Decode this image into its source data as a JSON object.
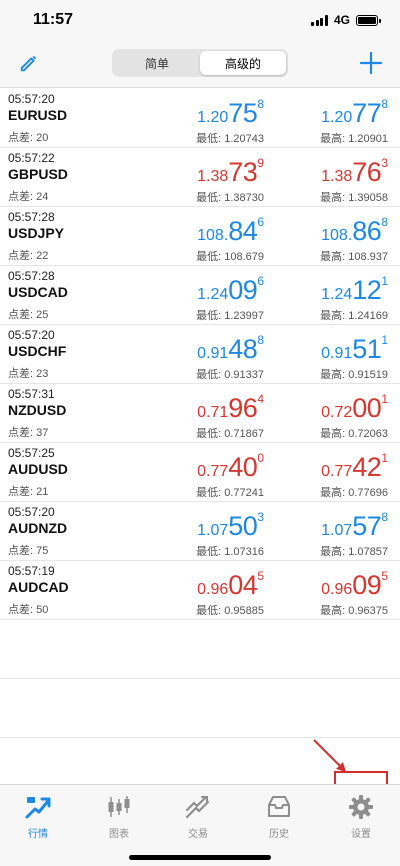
{
  "status": {
    "time": "11:57",
    "network": "4G"
  },
  "toolbar": {
    "segments": [
      {
        "label": "简单"
      },
      {
        "label": "高级的"
      }
    ]
  },
  "quotes": [
    {
      "time": "05:57:20",
      "symbol": "EURUSD",
      "spread": "点差: 20",
      "bid": {
        "small": "1.20",
        "big": "75",
        "sup": "8"
      },
      "ask": {
        "small": "1.20",
        "big": "77",
        "sup": "8"
      },
      "low": "最低: 1.20743",
      "high": "最高: 1.20901"
    },
    {
      "time": "05:57:22",
      "symbol": "GBPUSD",
      "spread": "点差: 24",
      "bid": {
        "small": "1.38",
        "big": "73",
        "sup": "9"
      },
      "ask": {
        "small": "1.38",
        "big": "76",
        "sup": "3"
      },
      "low": "最低: 1.38730",
      "high": "最高: 1.39058"
    },
    {
      "time": "05:57:28",
      "symbol": "USDJPY",
      "spread": "点差: 22",
      "bid": {
        "small": "108.",
        "big": "84",
        "sup": "6"
      },
      "ask": {
        "small": "108.",
        "big": "86",
        "sup": "8"
      },
      "low": "最低: 108.679",
      "high": "最高: 108.937"
    },
    {
      "time": "05:57:28",
      "symbol": "USDCAD",
      "spread": "点差: 25",
      "bid": {
        "small": "1.24",
        "big": "09",
        "sup": "6"
      },
      "ask": {
        "small": "1.24",
        "big": "12",
        "sup": "1"
      },
      "low": "最低: 1.23997",
      "high": "最高: 1.24169"
    },
    {
      "time": "05:57:20",
      "symbol": "USDCHF",
      "spread": "点差: 23",
      "bid": {
        "small": "0.91",
        "big": "48",
        "sup": "8"
      },
      "ask": {
        "small": "0.91",
        "big": "51",
        "sup": "1"
      },
      "low": "最低: 0.91337",
      "high": "最高: 0.91519"
    },
    {
      "time": "05:57:31",
      "symbol": "NZDUSD",
      "spread": "点差: 37",
      "bid": {
        "small": "0.71",
        "big": "96",
        "sup": "4"
      },
      "ask": {
        "small": "0.72",
        "big": "00",
        "sup": "1"
      },
      "low": "最低: 0.71867",
      "high": "最高: 0.72063"
    },
    {
      "time": "05:57:25",
      "symbol": "AUDUSD",
      "spread": "点差: 21",
      "bid": {
        "small": "0.77",
        "big": "40",
        "sup": "0"
      },
      "ask": {
        "small": "0.77",
        "big": "42",
        "sup": "1"
      },
      "low": "最低: 0.77241",
      "high": "最高: 0.77696"
    },
    {
      "time": "05:57:20",
      "symbol": "AUDNZD",
      "spread": "点差: 75",
      "bid": {
        "small": "1.07",
        "big": "50",
        "sup": "3"
      },
      "ask": {
        "small": "1.07",
        "big": "57",
        "sup": "8"
      },
      "low": "最低: 1.07316",
      "high": "最高: 1.07857"
    },
    {
      "time": "05:57:19",
      "symbol": "AUDCAD",
      "spread": "点差: 50",
      "bid": {
        "small": "0.96",
        "big": "04",
        "sup": "5"
      },
      "ask": {
        "small": "0.96",
        "big": "09",
        "sup": "5"
      },
      "low": "最低: 0.95885",
      "high": "最高: 0.96375"
    }
  ],
  "tabs": [
    {
      "label": "行情",
      "icon": "quotes-icon",
      "active": true
    },
    {
      "label": "图表",
      "icon": "chart-icon"
    },
    {
      "label": "交易",
      "icon": "trade-icon"
    },
    {
      "label": "历史",
      "icon": "history-icon"
    },
    {
      "label": "设置",
      "icon": "settings-icon"
    }
  ],
  "colors": {
    "up": "#1e88e5",
    "down": "#d7372f",
    "annotation": "#d32f2f"
  }
}
